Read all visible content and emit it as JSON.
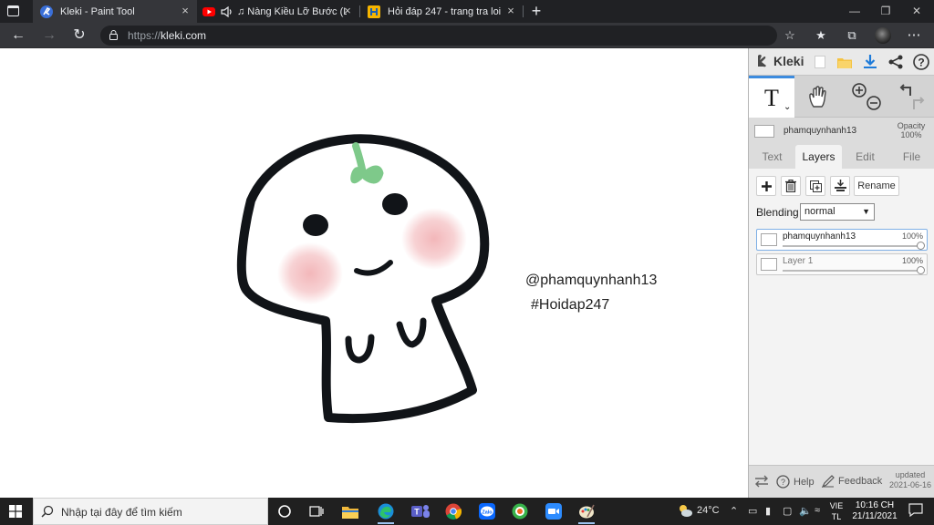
{
  "browser": {
    "tabs": [
      {
        "title": "Kleki - Paint Tool",
        "active": true
      },
      {
        "title": "♫ Nàng Kiều Lỡ Bước (Lofi",
        "active": false
      },
      {
        "title": "Hỏi đáp 247 - trang tra loi",
        "active": false
      }
    ],
    "close_glyph": "×",
    "new_tab_glyph": "+",
    "url_scheme": "https://",
    "url_host": "kleki.com"
  },
  "canvas": {
    "text_lines": [
      "@phamquynhanh13",
      "#Hoidap247"
    ],
    "colors": {
      "outline": "#111418",
      "sprout": "#7ec98a",
      "blush": "#f2b3b6"
    }
  },
  "kleki": {
    "brand": "Kleki",
    "tool_text_glyph": "T",
    "layer_name": "phamquynhanh13",
    "opacity_label": "Opacity",
    "opacity_value": "100%",
    "tabs": [
      "Text",
      "Layers",
      "Edit",
      "File"
    ],
    "active_tab": "Layers",
    "rename_label": "Rename",
    "blending_label": "Blending",
    "blending_value": "normal",
    "layers": [
      {
        "name": "phamquynhanh13",
        "opacity": "100%",
        "active": true
      },
      {
        "name": "Layer 1",
        "opacity": "100%",
        "active": false
      }
    ],
    "footer": {
      "help": "Help",
      "feedback": "Feedback",
      "updated_label": "updated",
      "updated_date": "2021-06-16"
    },
    "accent": "#3c8bde"
  },
  "taskbar": {
    "search_placeholder": "Nhập tại đây để tìm kiếm",
    "weather": "24°C",
    "lang_1": "VIE",
    "lang_2": "TL",
    "time": "10:16 CH",
    "date": "21/11/2021"
  }
}
